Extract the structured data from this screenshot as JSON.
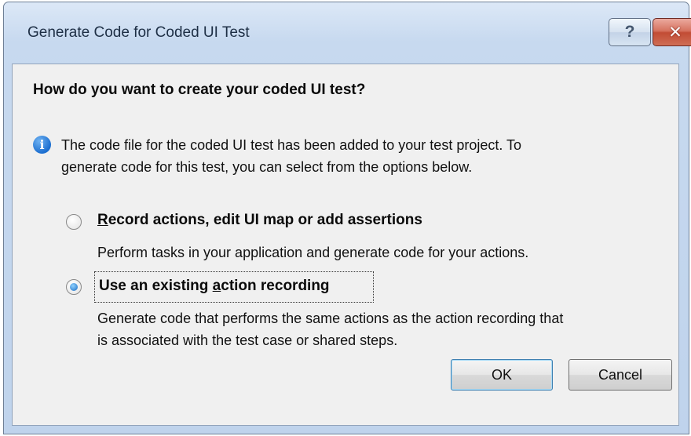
{
  "window": {
    "title": "Generate Code for Coded UI Test",
    "help_glyph": "?",
    "close_glyph": "✕"
  },
  "heading": "How do you want to create your coded UI test?",
  "info": {
    "icon": "info-icon",
    "line1": "The code file for the coded UI test has been added to your test project. To",
    "line2": "generate code for this test, you can select from the options below."
  },
  "options": [
    {
      "selected": false,
      "label_mnemonic": "R",
      "label_rest": "ecord actions, edit UI map or add assertions",
      "description": "Perform tasks in your application and generate code for your actions."
    },
    {
      "selected": true,
      "label_before": "Use an existing ",
      "label_mnemonic": "a",
      "label_after": "ction recording",
      "description_line1": "Generate code that performs the same actions as the action recording that",
      "description_line2": "is associated with the test case or shared steps."
    }
  ],
  "buttons": {
    "ok": "OK",
    "cancel": "Cancel"
  },
  "colors": {
    "title_bar": "#c7d9ef",
    "dialog_body": "#f0f0f0",
    "close_button": "#c24c35",
    "info_icon": "#1c6fd0"
  }
}
